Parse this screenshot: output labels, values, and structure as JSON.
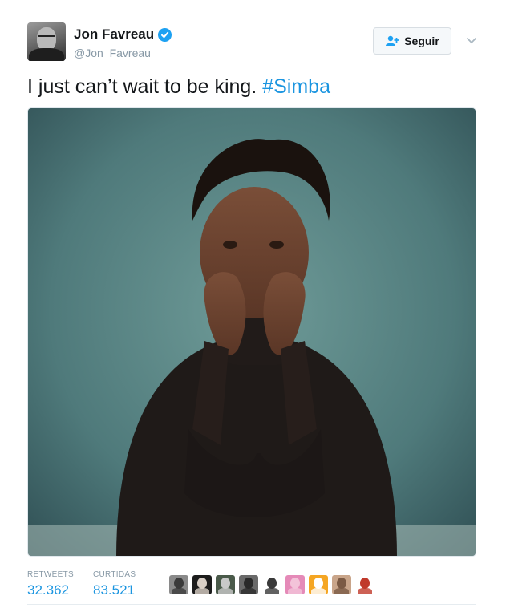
{
  "tweet": {
    "author": {
      "display_name": "Jon Favreau",
      "handle": "@Jon_Favreau",
      "verified": true,
      "avatar_icon": "profile-photo"
    },
    "follow_button": {
      "label": "Seguir",
      "icon": "add-user-icon"
    },
    "menu_icon": "chevron-down-icon",
    "text": "I just can’t wait to be king. ",
    "hashtag": "#Simba",
    "media": {
      "type": "photo",
      "description_icon": "photo"
    },
    "stats": {
      "retweets_label": "RETWEETS",
      "retweets_value": "32.362",
      "likes_label": "CURTIDAS",
      "likes_value": "83.521"
    },
    "likers": [
      {
        "name": "liker-avatar-1",
        "bg": "#8a8a8a",
        "fg": "#3a3a3a"
      },
      {
        "name": "liker-avatar-2",
        "bg": "#1c1c1c",
        "fg": "#d9cfc6"
      },
      {
        "name": "liker-avatar-3",
        "bg": "#4a5a4a",
        "fg": "#c9c9c9"
      },
      {
        "name": "liker-avatar-4",
        "bg": "#6a6a6a",
        "fg": "#2a2a2a"
      },
      {
        "name": "liker-avatar-5",
        "bg": "#ffffff",
        "fg": "#3a3a3a"
      },
      {
        "name": "liker-avatar-6",
        "bg": "#e58ab8",
        "fg": "#f3c3d9"
      },
      {
        "name": "liker-avatar-7",
        "bg": "#f5a623",
        "fg": "#ffffff"
      },
      {
        "name": "liker-avatar-8",
        "bg": "#c9a58a",
        "fg": "#7b5a44"
      },
      {
        "name": "liker-avatar-9",
        "bg": "#ffffff",
        "fg": "#c0392b"
      }
    ],
    "colors": {
      "accent": "#1b95e0",
      "verified_badge": "#1da1f2",
      "muted_text": "#8899a6"
    }
  }
}
